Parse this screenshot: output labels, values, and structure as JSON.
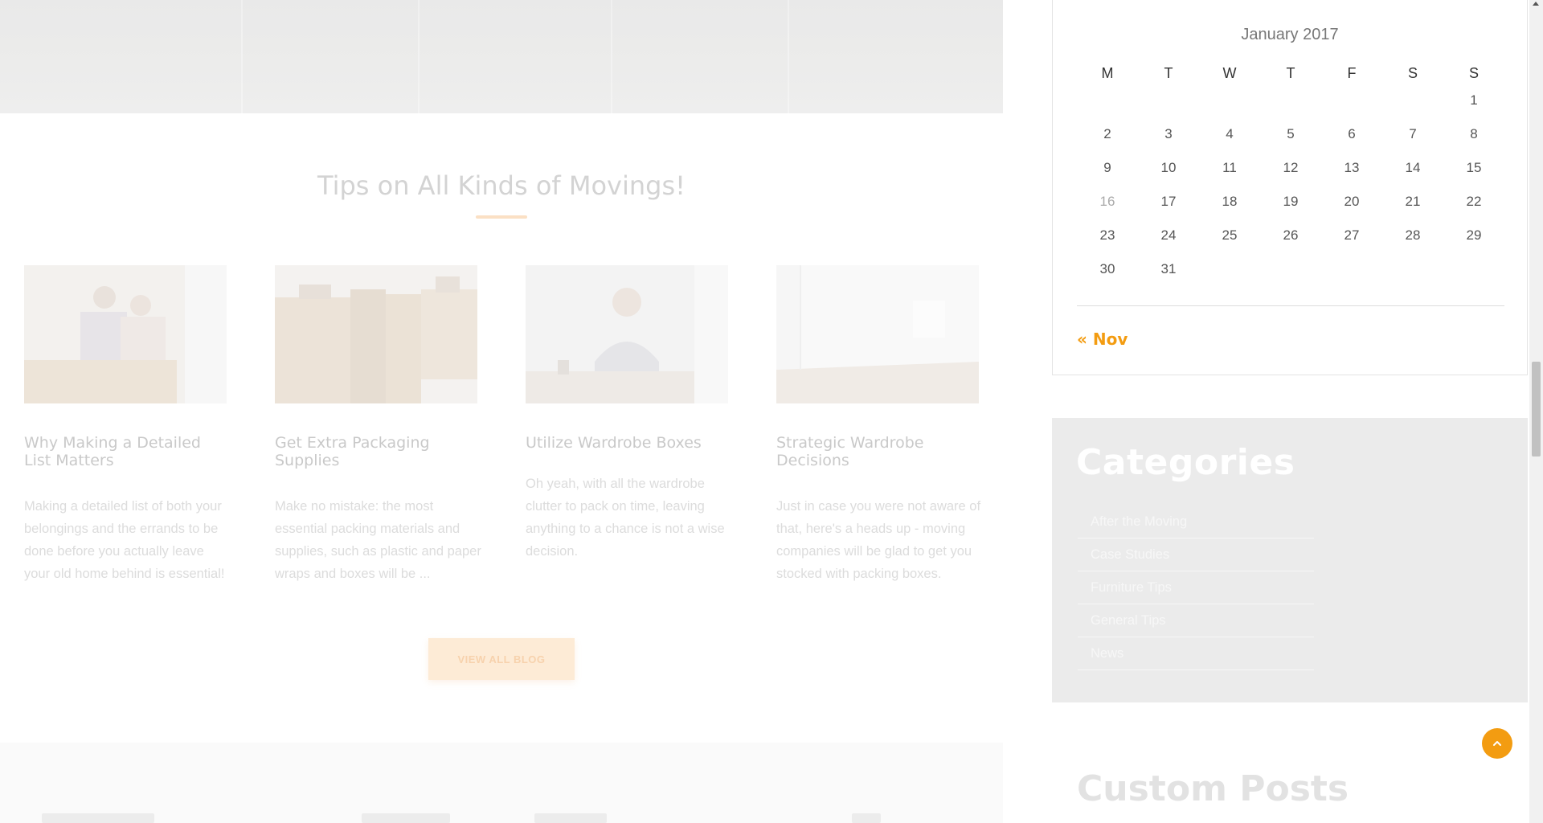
{
  "section": {
    "title": "Tips on All Kinds of Movings!",
    "view_all_label": "VIEW ALL BLOG"
  },
  "posts": [
    {
      "title": "Why Making a Detailed List Matters",
      "excerpt": "Making a detailed list of both your belongings and the errands to be done before you actually leave your old home behind is essential!"
    },
    {
      "title": "Get Extra Packaging Supplies",
      "excerpt": "Make no mistake: the most essential packing materials and supplies, such as plastic and paper wraps and boxes will be ..."
    },
    {
      "title": "Utilize Wardrobe Boxes",
      "excerpt": "Oh yeah, with all the wardrobe clutter to pack on time, leaving anything to a chance is not a wise decision."
    },
    {
      "title": "Strategic Wardrobe Decisions",
      "excerpt": "Just in case you were not aware of that, here's a heads up - moving companies will be glad to get you stocked with packing boxes."
    }
  ],
  "calendar": {
    "caption": "January 2017",
    "weekdays": [
      "M",
      "T",
      "W",
      "T",
      "F",
      "S",
      "S"
    ],
    "weeks": [
      [
        "",
        "",
        "",
        "",
        "",
        "",
        "1"
      ],
      [
        "2",
        "3",
        "4",
        "5",
        "6",
        "7",
        "8"
      ],
      [
        "9",
        "10",
        "11",
        "12",
        "13",
        "14",
        "15"
      ],
      [
        "16",
        "17",
        "18",
        "19",
        "20",
        "21",
        "22"
      ],
      [
        "23",
        "24",
        "25",
        "26",
        "27",
        "28",
        "29"
      ],
      [
        "30",
        "31",
        "",
        "",
        "",
        "",
        ""
      ]
    ],
    "prev_link": "« Nov"
  },
  "categories": {
    "title": "Categories",
    "items": [
      "After the Moving",
      "Case Studies",
      "Furniture Tips",
      "General Tips",
      "News"
    ]
  },
  "custom_posts": {
    "title": "Custom Posts"
  },
  "colors": {
    "accent": "#f39c11",
    "sidebar_bg": "#ebebeb"
  },
  "icons": {
    "back_to_top": "chevron-up-icon"
  }
}
